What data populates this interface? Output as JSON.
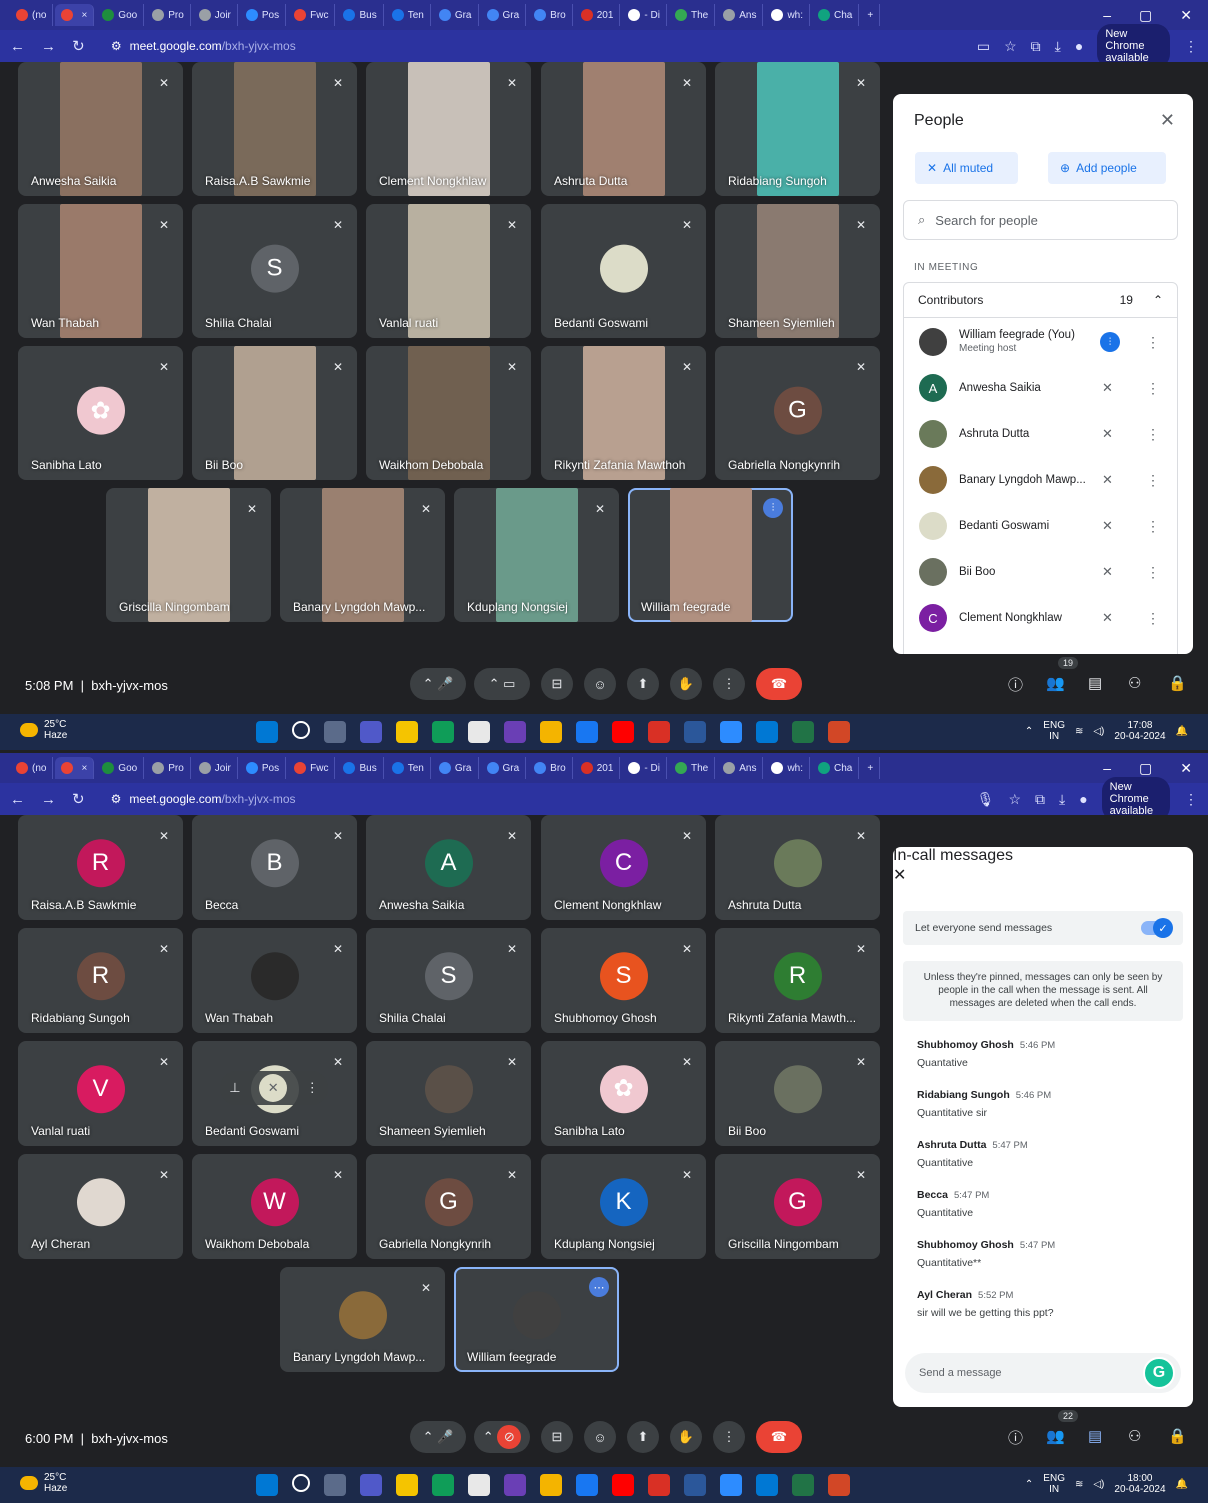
{
  "browser": {
    "tabs": [
      {
        "label": "(no",
        "icon": "gmail-icon",
        "color": "#ea4335"
      },
      {
        "label": "",
        "icon": "recording-icon",
        "color": "#ea4335",
        "active": true,
        "close": "×"
      },
      {
        "label": "Goo",
        "icon": "classroom-icon",
        "color": "#1e8e3e"
      },
      {
        "label": "Pro",
        "icon": "globe-icon",
        "color": "#9aa0a6"
      },
      {
        "label": "Joir",
        "icon": "globe-icon",
        "color": "#9aa0a6"
      },
      {
        "label": "Pos",
        "icon": "zoom-icon",
        "color": "#2d8cff"
      },
      {
        "label": "Fwc",
        "icon": "gmail-icon",
        "color": "#ea4335"
      },
      {
        "label": "Bus",
        "icon": "arrow-icon",
        "color": "#1a73e8"
      },
      {
        "label": "Ten",
        "icon": "blue-circle-icon",
        "color": "#1a73e8"
      },
      {
        "label": "Gra",
        "icon": "gradebook-icon",
        "color": "#4285f4"
      },
      {
        "label": "Gra",
        "icon": "gradebook-icon",
        "color": "#4285f4"
      },
      {
        "label": "Bro",
        "icon": "gradebook-icon",
        "color": "#4285f4"
      },
      {
        "label": "201",
        "icon": "doc-icon",
        "color": "#d93025"
      },
      {
        "label": "- Di",
        "icon": "g-icon",
        "color": "#ffffff"
      },
      {
        "label": "The",
        "icon": "lens-icon",
        "color": "#34a853"
      },
      {
        "label": "Ans",
        "icon": "globe-icon",
        "color": "#9aa0a6"
      },
      {
        "label": "wh:",
        "icon": "g-icon",
        "color": "#ffffff"
      },
      {
        "label": "Cha",
        "icon": "chat-icon",
        "color": "#10a37f"
      }
    ],
    "window_controls": [
      "–",
      "▢",
      "✕"
    ],
    "new_tab": "+",
    "url_host": "meet.google.com",
    "url_path": "/bxh-yjvx-mos",
    "new_chrome": "New Chrome available",
    "menu": "⋮"
  },
  "shot1": {
    "tiles": [
      {
        "name": "Anwesha Saikia",
        "kind": "video",
        "color": "#8a7060"
      },
      {
        "name": "Raisa.A.B Sawkmie",
        "kind": "video",
        "color": "#7a6a5a"
      },
      {
        "name": "Clement Nongkhlaw",
        "kind": "video",
        "color": "#c8c0b8"
      },
      {
        "name": "Ashruta Dutta",
        "kind": "video",
        "color": "#a08070"
      },
      {
        "name": "Ridabiang Sungoh",
        "kind": "video",
        "color": "#4ab0a8"
      },
      {
        "name": "Wan Thabah",
        "kind": "video",
        "color": "#9a7a6a"
      },
      {
        "name": "Shilia Chalai",
        "kind": "avatar",
        "letter": "S",
        "color": "#5f6368"
      },
      {
        "name": "Vanlal ruati",
        "kind": "video",
        "color": "#b8b0a0"
      },
      {
        "name": "Bedanti Goswami",
        "kind": "avatar",
        "letter": "",
        "color": "#dcdcc8"
      },
      {
        "name": "Shameen Syiemlieh",
        "kind": "video",
        "color": "#8a7a70"
      },
      {
        "name": "Sanibha Lato",
        "kind": "avatar",
        "letter": "✿",
        "color": "#f0c8d0"
      },
      {
        "name": "Bii Boo",
        "kind": "video",
        "color": "#b0a090"
      },
      {
        "name": "Waikhom Debobala",
        "kind": "video",
        "color": "#706050"
      },
      {
        "name": "Rikynti Zafania Mawthoh",
        "kind": "video",
        "color": "#b8a090"
      },
      {
        "name": "Gabriella Nongkynrih",
        "kind": "avatar",
        "letter": "G",
        "color": "#6d4c41"
      },
      {
        "name": "Griscilla Ningombam",
        "kind": "video",
        "color": "#c0b0a0"
      },
      {
        "name": "Banary Lyngdoh Mawp...",
        "kind": "video",
        "color": "#9a8070"
      },
      {
        "name": "Kduplang Nongsiej",
        "kind": "video",
        "color": "#6a9a8a"
      },
      {
        "name": "William feegrade",
        "kind": "self",
        "color": "#b09080"
      }
    ],
    "people": {
      "title": "People",
      "close": "✕",
      "all_muted": "All muted",
      "add_people": "Add people",
      "search_placeholder": "Search for people",
      "section": "IN MEETING",
      "group": "Contributors",
      "count": "19",
      "caret": "⌃",
      "rows": [
        {
          "name": "William feegrade (You)",
          "sub": "Meeting host",
          "letter": "",
          "color": "#404040",
          "host": true
        },
        {
          "name": "Anwesha Saikia",
          "sub": "",
          "letter": "A",
          "color": "#1e6b52"
        },
        {
          "name": "Ashruta Dutta",
          "sub": "",
          "letter": "",
          "color": "#6a7a5a"
        },
        {
          "name": "Banary Lyngdoh Mawp...",
          "sub": "",
          "letter": "",
          "color": "#8a6a3a"
        },
        {
          "name": "Bedanti Goswami",
          "sub": "",
          "letter": "",
          "color": "#dcdcc8"
        },
        {
          "name": "Bii Boo",
          "sub": "",
          "letter": "",
          "color": "#6a7060"
        },
        {
          "name": "Clement Nongkhlaw",
          "sub": "",
          "letter": "C",
          "color": "#7b1fa2"
        }
      ]
    },
    "clock": "5:08 PM",
    "code": "bxh-yjvx-mos",
    "people_badge": "19",
    "taskbar": {
      "temp": "25°C",
      "cond": "Haze",
      "lang1": "ENG",
      "lang2": "IN",
      "time": "17:08",
      "date": "20-04-2024"
    }
  },
  "shot2": {
    "tiles": [
      {
        "name": "Raisa.A.B Sawkmie",
        "letter": "R",
        "color": "#c2185b"
      },
      {
        "name": "Becca",
        "letter": "B",
        "color": "#5f6368"
      },
      {
        "name": "Anwesha Saikia",
        "letter": "A",
        "color": "#1e6b52"
      },
      {
        "name": "Clement Nongkhlaw",
        "letter": "C",
        "color": "#7b1fa2"
      },
      {
        "name": "Ashruta Dutta",
        "letter": "",
        "color": "#6a7a5a"
      },
      {
        "name": "Ridabiang Sungoh",
        "letter": "R",
        "color": "#6d4c41"
      },
      {
        "name": "Wan Thabah",
        "letter": "",
        "color": "#2a2a2a"
      },
      {
        "name": "Shilia Chalai",
        "letter": "S",
        "color": "#5f6368"
      },
      {
        "name": "Shubhomoy Ghosh",
        "letter": "S",
        "color": "#e8531f"
      },
      {
        "name": "Rikynti Zafania Mawth...",
        "letter": "R",
        "color": "#2e7d32"
      },
      {
        "name": "Vanlal ruati",
        "letter": "V",
        "color": "#d81b60"
      },
      {
        "name": "Bedanti Goswami",
        "letter": "",
        "color": "#dcdcc8",
        "hover": true
      },
      {
        "name": "Shameen Syiemlieh",
        "letter": "",
        "color": "#5a5048"
      },
      {
        "name": "Sanibha Lato",
        "letter": "✿",
        "color": "#f0c8d0"
      },
      {
        "name": "Bii Boo",
        "letter": "",
        "color": "#6a7060"
      },
      {
        "name": "Ayl Cheran",
        "letter": "",
        "color": "#e0d8d0"
      },
      {
        "name": "Waikhom Debobala",
        "letter": "W",
        "color": "#c2185b"
      },
      {
        "name": "Gabriella Nongkynrih",
        "letter": "G",
        "color": "#6d4c41"
      },
      {
        "name": "Kduplang Nongsiej",
        "letter": "K",
        "color": "#1565c0"
      },
      {
        "name": "Griscilla Ningombam",
        "letter": "G",
        "color": "#c2185b"
      },
      {
        "name": "Banary Lyngdoh Mawp...",
        "letter": "",
        "color": "#8a6a3a"
      },
      {
        "name": "William feegrade",
        "letter": "",
        "color": "#404040",
        "self": true
      }
    ],
    "chat": {
      "title": "In-call messages",
      "close": "✕",
      "toggle_label": "Let everyone send messages",
      "notice": "Unless they're pinned, messages can only be seen by people in the call when the message is sent. All messages are deleted when the call ends.",
      "messages": [
        {
          "who": "Shubhomoy Ghosh",
          "time": "5:46 PM",
          "text": "Quantative"
        },
        {
          "who": "Ridabiang Sungoh",
          "time": "5:46 PM",
          "text": "Quantitative sir"
        },
        {
          "who": "Ashruta Dutta",
          "time": "5:47 PM",
          "text": "Quantitative"
        },
        {
          "who": "Becca",
          "time": "5:47 PM",
          "text": "Quantitative"
        },
        {
          "who": "Shubhomoy Ghosh",
          "time": "5:47 PM",
          "text": "Quantitative**"
        },
        {
          "who": "Ayl Cheran",
          "time": "5:52 PM",
          "text": "sir will we be getting this ppt?"
        }
      ],
      "placeholder": "Send a message"
    },
    "clock": "6:00 PM",
    "code": "bxh-yjvx-mos",
    "people_badge": "22",
    "taskbar": {
      "temp": "25°C",
      "cond": "Haze",
      "lang1": "ENG",
      "lang2": "IN",
      "time": "18:00",
      "date": "20-04-2024"
    }
  },
  "icons": {
    "mic_off": "🎙̸",
    "muted": "✕",
    "more": "⋮",
    "info": "ⓘ",
    "people": "👥",
    "chat": "▤",
    "activities": "⚇",
    "lock": "🔒",
    "mic": "🎤",
    "cam": "▭",
    "cc": "CC",
    "emoji": "☺",
    "present": "⬆",
    "hand": "✋",
    "hangup": "☎",
    "caret_up": "⌃"
  },
  "colors": {
    "accent": "#1a73e8",
    "hangup": "#ea4335",
    "tab_strip": "#2a2f8f"
  }
}
